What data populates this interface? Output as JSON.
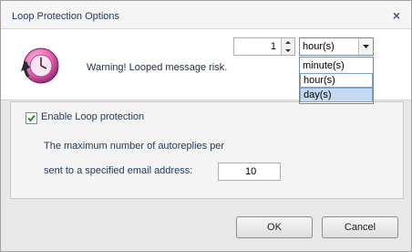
{
  "window": {
    "title": "Loop Protection Options",
    "close_glyph": "×"
  },
  "header": {
    "icon": "loop-warning-icon",
    "warning_text": "Warning! Looped message risk."
  },
  "options": {
    "enable_label": "Enable Loop protection",
    "enable_checked": true,
    "max_autoreplies_label": "The maximum number of autoreplies per",
    "max_autoreplies_value": "1",
    "per_email_label": "sent to a specified email address:",
    "per_email_value": "10",
    "period": {
      "selected": "hour(s)",
      "options": [
        "minute(s)",
        "hour(s)",
        "day(s)"
      ],
      "highlighted": "day(s)"
    }
  },
  "buttons": {
    "ok": "OK",
    "cancel": "Cancel"
  },
  "colors": {
    "accent_pink": "#e04aa0",
    "selection": "#c5d9f1",
    "check_green": "#2f8a2f"
  }
}
